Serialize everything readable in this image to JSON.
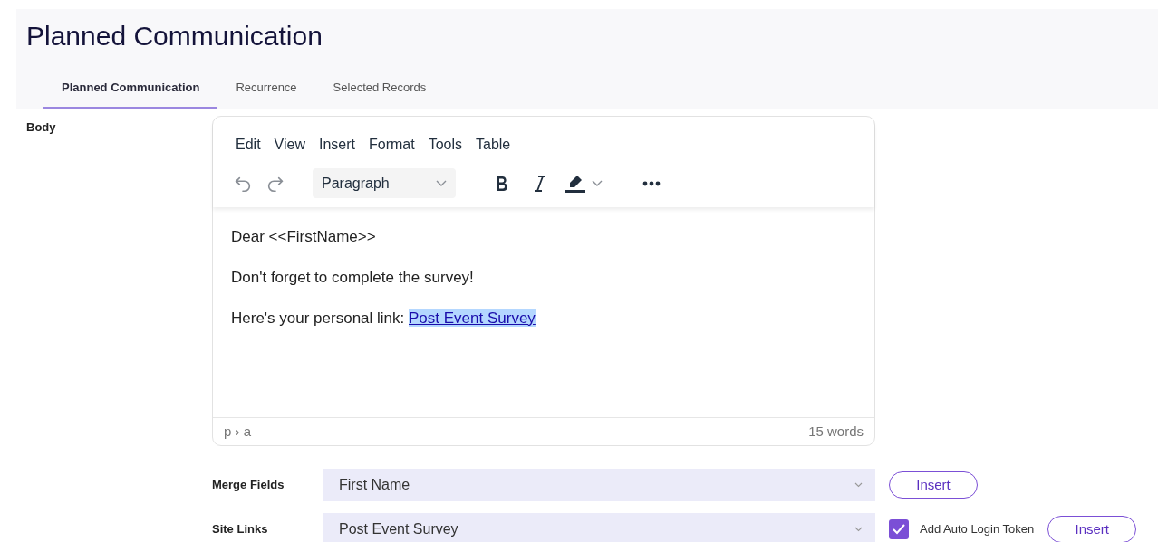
{
  "title": "Planned Communication",
  "tabs": [
    {
      "label": "Planned Communication",
      "selected": true
    },
    {
      "label": "Recurrence",
      "selected": false
    },
    {
      "label": "Selected Records",
      "selected": false
    }
  ],
  "body_label": "Body",
  "editor": {
    "menu": [
      "Edit",
      "View",
      "Insert",
      "Format",
      "Tools",
      "Table"
    ],
    "block_format": "Paragraph",
    "lines": [
      {
        "text": "Dear <<FirstName>>"
      },
      {
        "text": "Don't forget to complete the survey!"
      },
      {
        "text": "Here's your personal link: ",
        "link": "Post Event Survey",
        "link_selected": true
      }
    ],
    "path": "p › a",
    "word_count": "15 words"
  },
  "rows": [
    {
      "label": "Merge Fields",
      "value": "First Name",
      "button": "Insert"
    },
    {
      "label": "Site Links",
      "value": "Post Event Survey",
      "checkbox": {
        "label": "Add Auto Login Token",
        "checked": true
      },
      "button": "Insert"
    }
  ]
}
